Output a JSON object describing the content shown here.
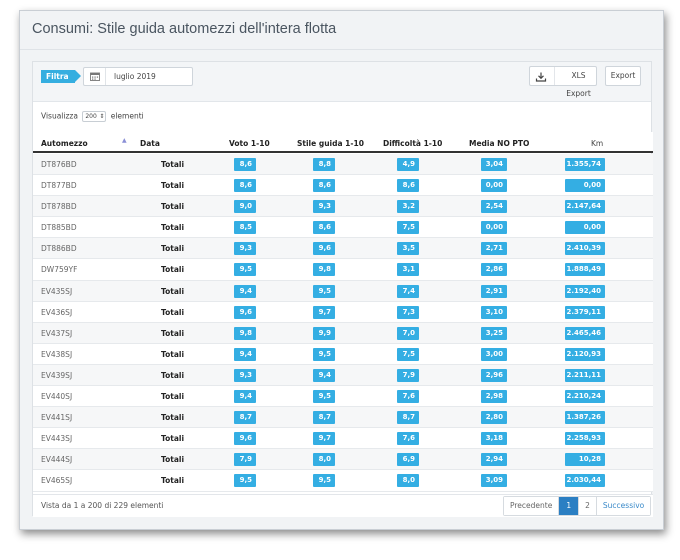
{
  "page": {
    "title": "Consumi: Stile guida automezzi dell'intera flotta"
  },
  "filter": {
    "label": "Filtra",
    "date_value": "luglio 2019",
    "calendar_icon": "calendar-icon"
  },
  "toolbar": {
    "xls_label": "XLS Export",
    "export_label": "Export",
    "download_icon": "download-icon"
  },
  "length": {
    "prefix": "Visualizza",
    "value": "200",
    "suffix": "elementi"
  },
  "table": {
    "columns": {
      "automezzo": "Automezzo",
      "data": "Data",
      "voto": "Voto 1-10",
      "stile": "Stile guida 1-10",
      "difficolta": "Difficoltà 1-10",
      "media": "Media NO PTO",
      "km": "Km"
    },
    "accent_color": "#34aee3",
    "rows": [
      {
        "code": "DT876BD",
        "data": "Totali",
        "voto": "8,6",
        "stile": "8,8",
        "difficolta": "4,9",
        "media": "3,04",
        "km": "1.355,74"
      },
      {
        "code": "DT877BD",
        "data": "Totali",
        "voto": "8,6",
        "stile": "8,6",
        "difficolta": "8,6",
        "media": "0,00",
        "km": "0,00"
      },
      {
        "code": "DT878BD",
        "data": "Totali",
        "voto": "9,0",
        "stile": "9,3",
        "difficolta": "3,2",
        "media": "2,54",
        "km": "2.147,64"
      },
      {
        "code": "DT885BD",
        "data": "Totali",
        "voto": "8,5",
        "stile": "8,6",
        "difficolta": "7,5",
        "media": "0,00",
        "km": "0,00"
      },
      {
        "code": "DT886BD",
        "data": "Totali",
        "voto": "9,3",
        "stile": "9,6",
        "difficolta": "3,5",
        "media": "2,71",
        "km": "2.410,39"
      },
      {
        "code": "DW759YF",
        "data": "Totali",
        "voto": "9,5",
        "stile": "9,8",
        "difficolta": "3,1",
        "media": "2,86",
        "km": "1.888,49"
      },
      {
        "code": "EV435SJ",
        "data": "Totali",
        "voto": "9,4",
        "stile": "9,5",
        "difficolta": "7,4",
        "media": "2,91",
        "km": "2.192,40"
      },
      {
        "code": "EV436SJ",
        "data": "Totali",
        "voto": "9,6",
        "stile": "9,7",
        "difficolta": "7,3",
        "media": "3,10",
        "km": "2.379,11"
      },
      {
        "code": "EV437SJ",
        "data": "Totali",
        "voto": "9,8",
        "stile": "9,9",
        "difficolta": "7,0",
        "media": "3,25",
        "km": "2.465,46"
      },
      {
        "code": "EV438SJ",
        "data": "Totali",
        "voto": "9,4",
        "stile": "9,5",
        "difficolta": "7,5",
        "media": "3,00",
        "km": "2.120,93"
      },
      {
        "code": "EV439SJ",
        "data": "Totali",
        "voto": "9,3",
        "stile": "9,4",
        "difficolta": "7,9",
        "media": "2,96",
        "km": "2.211,11"
      },
      {
        "code": "EV440SJ",
        "data": "Totali",
        "voto": "9,4",
        "stile": "9,5",
        "difficolta": "7,6",
        "media": "2,98",
        "km": "2.210,24"
      },
      {
        "code": "EV441SJ",
        "data": "Totali",
        "voto": "8,7",
        "stile": "8,7",
        "difficolta": "8,7",
        "media": "2,80",
        "km": "1.387,26"
      },
      {
        "code": "EV443SJ",
        "data": "Totali",
        "voto": "9,6",
        "stile": "9,7",
        "difficolta": "7,6",
        "media": "3,18",
        "km": "2.258,93"
      },
      {
        "code": "EV444SJ",
        "data": "Totali",
        "voto": "7,9",
        "stile": "8,0",
        "difficolta": "6,9",
        "media": "2,94",
        "km": "10,28"
      },
      {
        "code": "EV465SJ",
        "data": "Totali",
        "voto": "9,5",
        "stile": "9,5",
        "difficolta": "8,0",
        "media": "3,09",
        "km": "2.030,44"
      }
    ]
  },
  "footer": {
    "info": "Vista da 1 a 200 di 229 elementi",
    "prev_label": "Precedente",
    "pages": [
      "1",
      "2"
    ],
    "next_label": "Successivo"
  }
}
